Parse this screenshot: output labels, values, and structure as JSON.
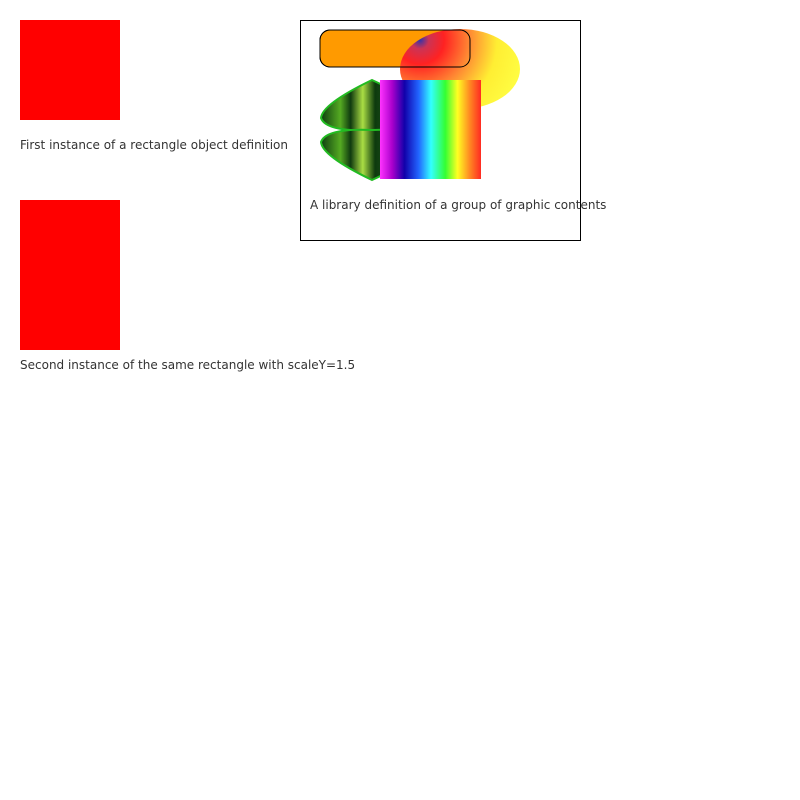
{
  "colors": {
    "rect_fill": "#ff0000",
    "caption_text": "#333333",
    "box_border": "#000000",
    "rounded_rect_fill": "#ff9a00",
    "ellipse_base": "#ffff33",
    "leaf_stroke": "#22bb22"
  },
  "instances": {
    "first_caption": "First instance of a rectangle object definition",
    "second_caption": "Second instance of the same rectangle with scaleY=1.5"
  },
  "library": {
    "caption": "A library definition of a group of graphic contents"
  }
}
